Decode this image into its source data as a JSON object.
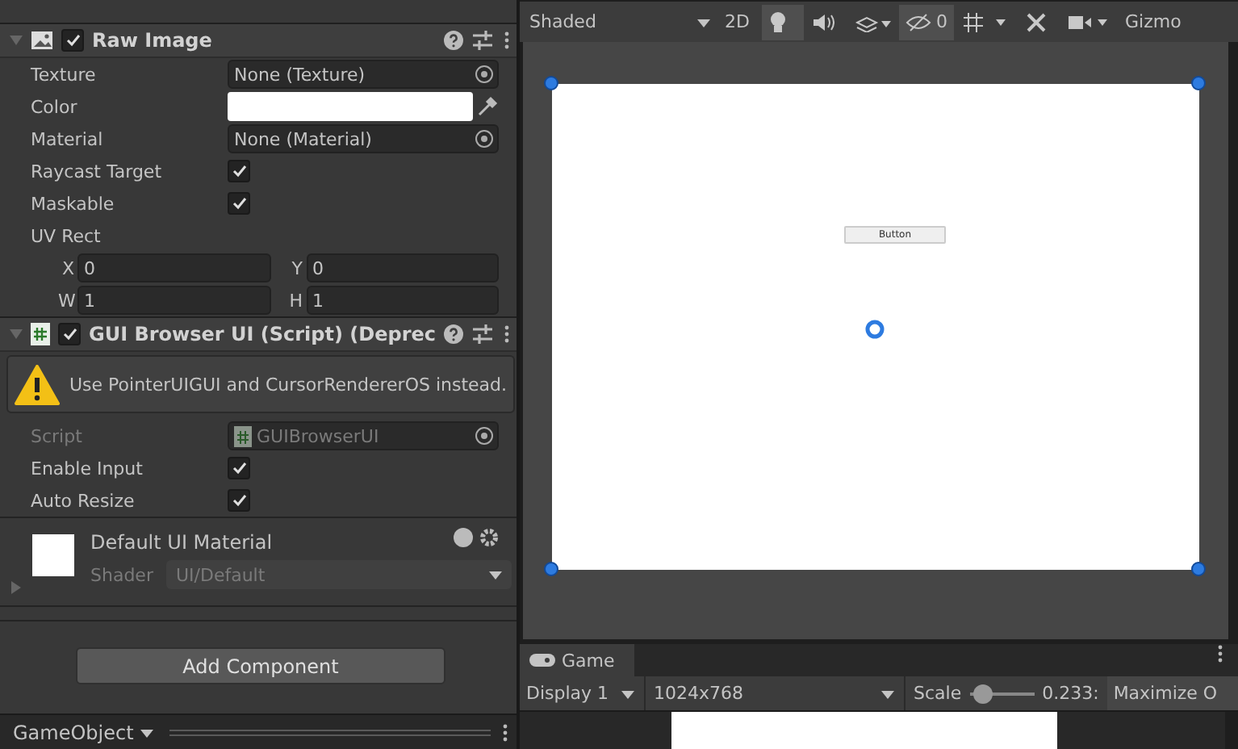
{
  "inspector": {
    "components": [
      {
        "kind": "image",
        "title": "Raw Image",
        "enabled": true,
        "expanded": true,
        "rows": [
          {
            "kind": "object",
            "label": "Texture",
            "value": "None (Texture)"
          },
          {
            "kind": "color",
            "label": "Color",
            "color": "#ffffff"
          },
          {
            "kind": "object",
            "label": "Material",
            "value": "None (Material)"
          },
          {
            "kind": "toggle",
            "label": "Raycast Target",
            "checked": true
          },
          {
            "kind": "toggle",
            "label": "Maskable",
            "checked": true
          },
          {
            "kind": "heading",
            "label": "UV Rect"
          },
          {
            "kind": "pair",
            "fields": [
              {
                "label": "X",
                "value": "0"
              },
              {
                "label": "Y",
                "value": "0"
              }
            ]
          },
          {
            "kind": "pair",
            "fields": [
              {
                "label": "W",
                "value": "1"
              },
              {
                "label": "H",
                "value": "1"
              }
            ]
          }
        ]
      },
      {
        "kind": "script",
        "title": "GUI Browser UI (Script) (Deprec",
        "enabled": true,
        "expanded": true,
        "warning": "Use PointerUIGUI and CursorRendererOS instead.",
        "rows": [
          {
            "kind": "script",
            "label": "Script",
            "value": "GUIBrowserUI",
            "disabled": true
          },
          {
            "kind": "toggle",
            "label": "Enable Input",
            "checked": true
          },
          {
            "kind": "toggle",
            "label": "Auto Resize",
            "checked": true
          }
        ]
      }
    ],
    "material": {
      "name": "Default UI Material",
      "shader_label": "Shader",
      "shader": "UI/Default",
      "expanded": false
    },
    "add_button": "Add Component",
    "footer": "GameObject"
  },
  "scene": {
    "toolbar": [
      {
        "kind": "dropdown",
        "label": "Shaded"
      },
      {
        "kind": "text",
        "label": "2D",
        "on": false
      },
      {
        "kind": "light",
        "on": true
      },
      {
        "kind": "audio",
        "on": false
      },
      {
        "kind": "effects",
        "on": false
      },
      {
        "kind": "hidden",
        "label": "0",
        "on": true
      },
      {
        "kind": "grid",
        "on": false
      },
      {
        "kind": "tools",
        "on": false
      },
      {
        "kind": "camera",
        "on": false
      },
      {
        "kind": "text",
        "label": "Gizmo",
        "on": false
      }
    ],
    "canvas_button": "Button"
  },
  "game": {
    "tab": "Game",
    "display": "Display 1",
    "resolution": "1024x768",
    "scale_label": "Scale",
    "scale": {
      "level": 0.1
    },
    "scale_value": "0.233:",
    "maximize": "Maximize O"
  }
}
